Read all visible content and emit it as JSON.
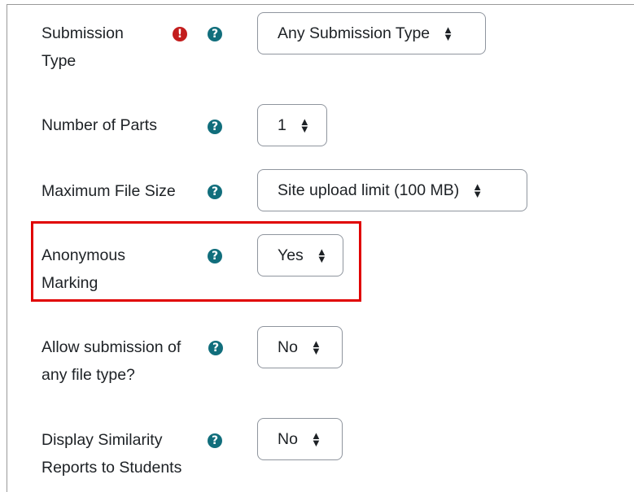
{
  "colors": {
    "help_icon": "#116e7c",
    "required_icon": "#c31d1d",
    "highlight": "#e00000"
  },
  "rows": [
    {
      "label_line1": "Submission",
      "label_line2": "Type",
      "required_icon": "exclamation-circle-icon",
      "help_icon": "question-circle-icon",
      "value": "Any Submission Type"
    },
    {
      "label_line1": "Number of Parts",
      "help_icon": "question-circle-icon",
      "value": "1"
    },
    {
      "label_line1": "Maximum File Size",
      "help_icon": "question-circle-icon",
      "value": "Site upload limit (100 MB)"
    },
    {
      "label_line1": "Anonymous",
      "label_line2": "Marking",
      "help_icon": "question-circle-icon",
      "value": "Yes"
    },
    {
      "label_line1": "Allow submission of",
      "label_line2": "any file type?",
      "help_icon": "question-circle-icon",
      "value": "No"
    },
    {
      "label_line1": "Display Similarity",
      "label_line2": "Reports to Students",
      "help_icon": "question-circle-icon",
      "value": "No"
    }
  ],
  "glyphs": {
    "help": "?",
    "required": "!",
    "sort_up": "▲",
    "sort_down": "▼"
  }
}
